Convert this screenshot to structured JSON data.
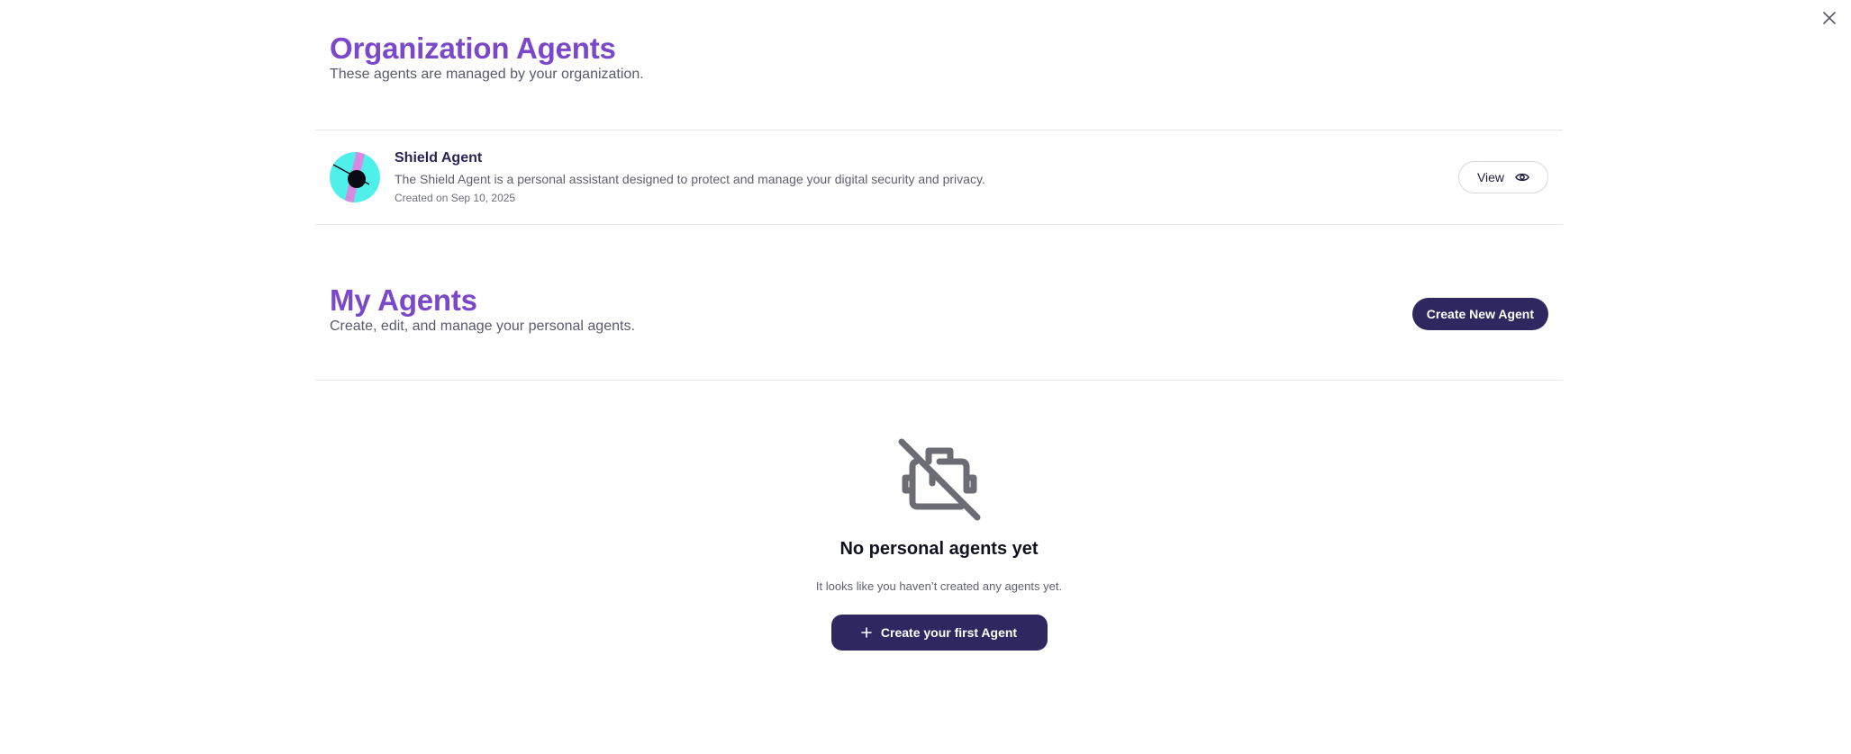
{
  "org": {
    "title": "Organization Agents",
    "subtitle": "These agents are managed by your organization.",
    "agents": [
      {
        "name": "Shield Agent",
        "description": "The Shield Agent is a personal assistant designed to protect and manage your digital security and privacy.",
        "created": "Created on Sep 10, 2025",
        "view_label": "View"
      }
    ]
  },
  "mine": {
    "title": "My Agents",
    "subtitle": "Create, edit, and manage your personal agents.",
    "create_label": "Create New Agent"
  },
  "empty": {
    "title": "No personal agents yet",
    "text": "It looks like you haven’t created any agents yet.",
    "button_label": "Create your first Agent"
  },
  "colors": {
    "accent": "#7a48c8",
    "primary": "#2e2760",
    "avatar_bg": "#4ff0ea",
    "avatar_stripe": "#d78ae0"
  },
  "icons": {
    "close": "close-icon",
    "view": "eye-icon",
    "empty": "robot-off-icon",
    "plus": "plus-icon"
  }
}
